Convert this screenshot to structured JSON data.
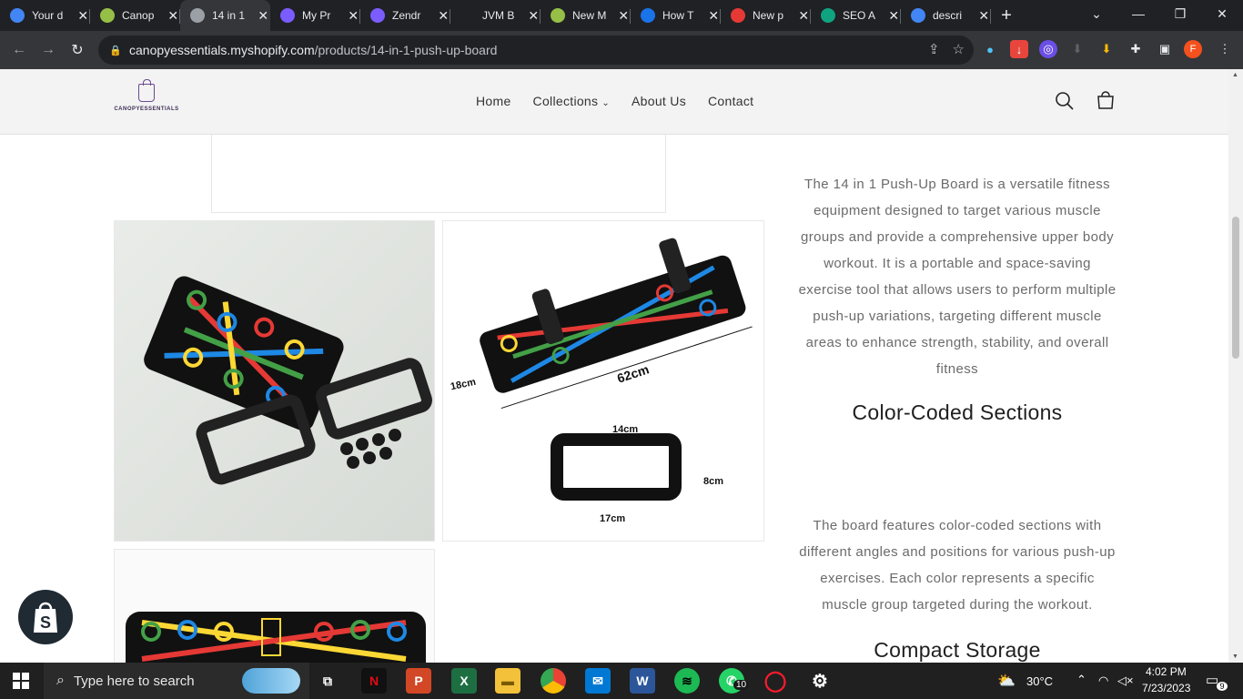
{
  "browser": {
    "tabs": [
      {
        "title": "Your d",
        "favicon": "google-icon",
        "color": "#4285f4"
      },
      {
        "title": "Canop",
        "favicon": "shopify-icon",
        "color": "#95bf47"
      },
      {
        "title": "14 in 1",
        "favicon": "globe-icon",
        "color": "#9aa0a6",
        "active": true
      },
      {
        "title": "My Pr",
        "favicon": "zendrop-icon",
        "color": "#7b5cff"
      },
      {
        "title": "Zendr",
        "favicon": "zendrop-icon",
        "color": "#7b5cff"
      },
      {
        "title": "JVM B",
        "favicon": "blank-icon",
        "color": "#202124"
      },
      {
        "title": "New M",
        "favicon": "shopify-icon",
        "color": "#95bf47"
      },
      {
        "title": "How T",
        "favicon": "s-icon",
        "color": "#1a73e8"
      },
      {
        "title": "New p",
        "favicon": "rainbow-icon",
        "color": "#e53935"
      },
      {
        "title": "SEO A",
        "favicon": "openai-icon",
        "color": "#10a37f"
      },
      {
        "title": "descri",
        "favicon": "google-icon",
        "color": "#4285f4"
      }
    ],
    "url_host": "canopyessentials.myshopify.com",
    "url_path": "/products/14-in-1-push-up-board",
    "profile_letter": "F"
  },
  "site": {
    "logo_text": "CANOPYESSENTIALS",
    "nav": [
      {
        "label": "Home"
      },
      {
        "label": "Collections",
        "has_dropdown": true
      },
      {
        "label": "About Us"
      },
      {
        "label": "Contact"
      }
    ]
  },
  "product": {
    "image1_alt": "",
    "image2_labels": {
      "length": "62cm",
      "width": "18cm",
      "handle_top": "14cm",
      "handle_bottom": "17cm",
      "handle_height": "8cm"
    },
    "description_intro": "The 14 in 1 Push-Up Board is a versatile fitness equipment designed to target various muscle groups and provide a comprehensive upper body workout. It is a portable and space-saving exercise tool that allows users to perform multiple push-up variations, targeting different muscle areas to enhance strength, stability, and overall fitness",
    "section1_heading": "Color-Coded Sections",
    "section1_text": "The board features color-coded sections with different angles and positions for various push-up exercises. Each color represents a specific muscle group targeted during the workout.",
    "section2_heading": "Compact Storage"
  },
  "taskbar": {
    "search_placeholder": "Type here to search",
    "weather": "30°C",
    "time": "4:02 PM",
    "date": "7/23/2023",
    "whatsapp_badge": "10",
    "notification_count": "9"
  }
}
